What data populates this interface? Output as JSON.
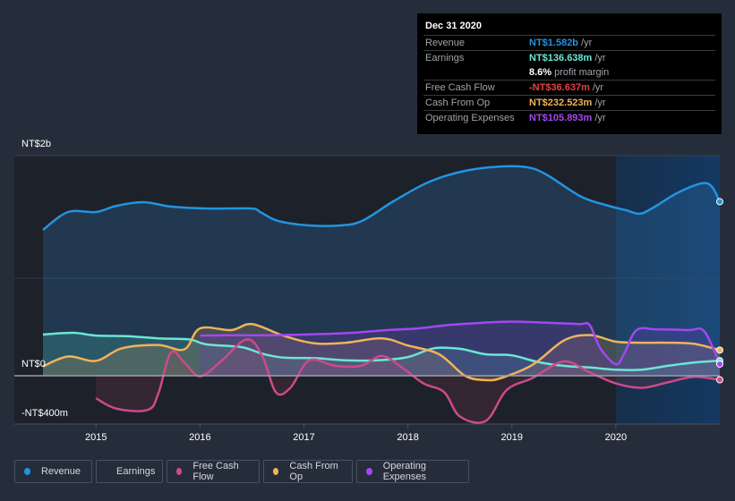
{
  "tooltip": {
    "date": "Dec 31 2020",
    "rows": [
      {
        "label": "Revenue",
        "value": "NT$1.582b",
        "unit": "/yr",
        "color": "#2394df"
      },
      {
        "label": "Earnings",
        "value": "NT$136.638m",
        "unit": "/yr",
        "color": "#6ce6d4"
      },
      {
        "label": "",
        "value": "8.6%",
        "unit": "profit margin",
        "color": "#ffffff"
      },
      {
        "label": "Free Cash Flow",
        "value": "-NT$36.637m",
        "unit": "/yr",
        "color": "#e64141"
      },
      {
        "label": "Cash From Op",
        "value": "NT$232.523m",
        "unit": "/yr",
        "color": "#f0b35a"
      },
      {
        "label": "Operating Expenses",
        "value": "NT$105.893m",
        "unit": "/yr",
        "color": "#a447f0"
      }
    ]
  },
  "legend": [
    {
      "label": "Revenue",
      "color": "#2394df"
    },
    {
      "label": "Earnings",
      "color": "#6ce6d4"
    },
    {
      "label": "Free Cash Flow",
      "color": "#cc4a8b"
    },
    {
      "label": "Cash From Op",
      "color": "#f0b35a"
    },
    {
      "label": "Operating Expenses",
      "color": "#a447f0"
    }
  ],
  "chart_data": {
    "type": "area",
    "title": "",
    "xlabel": "",
    "ylabel": "",
    "y_tick_labels": [
      "NT$2b",
      "NT$0",
      "-NT$400m"
    ],
    "y_ticks": [
      2000,
      0,
      -400
    ],
    "ylim": [
      -440,
      2000
    ],
    "xlim": [
      2014.49,
      2021.0
    ],
    "x_ticks": [
      2015,
      2016,
      2017,
      2018,
      2019,
      2020
    ],
    "x_tick_labels": [
      "2015",
      "2016",
      "2017",
      "2018",
      "2019",
      "2020"
    ],
    "unit": "NT$ millions",
    "highlight_start": 2020.0,
    "grid": true,
    "legend_position": "bottom",
    "series": [
      {
        "name": "Revenue",
        "color": "#2394df",
        "x": [
          2014.49,
          2014.73,
          2015.0,
          2015.2,
          2015.46,
          2015.72,
          2016.06,
          2016.49,
          2016.58,
          2016.75,
          2017.05,
          2017.35,
          2017.56,
          2017.86,
          2018.21,
          2018.55,
          2018.9,
          2019.15,
          2019.33,
          2019.67,
          2019.93,
          2020.1,
          2020.23,
          2020.36,
          2020.62,
          2020.88,
          2021.0
        ],
        "values": [
          1325,
          1488,
          1488,
          1545,
          1577,
          1537,
          1520,
          1520,
          1488,
          1407,
          1366,
          1366,
          1407,
          1585,
          1764,
          1862,
          1902,
          1894,
          1829,
          1626,
          1545,
          1504,
          1472,
          1528,
          1675,
          1748,
          1582
        ]
      },
      {
        "name": "Earnings",
        "color": "#6ce6d4",
        "x": [
          2014.49,
          2014.78,
          2015.0,
          2015.3,
          2015.6,
          2015.9,
          2016.06,
          2016.4,
          2016.6,
          2016.8,
          2017.1,
          2017.4,
          2017.7,
          2018.0,
          2018.25,
          2018.5,
          2018.75,
          2019.0,
          2019.25,
          2019.5,
          2019.75,
          2020.0,
          2020.25,
          2020.5,
          2020.75,
          2021.0
        ],
        "values": [
          375,
          390,
          365,
          360,
          340,
          330,
          285,
          260,
          200,
          165,
          160,
          140,
          140,
          170,
          250,
          245,
          195,
          185,
          125,
          90,
          75,
          55,
          55,
          90,
          120,
          137
        ]
      },
      {
        "name": "Free Cash Flow",
        "color": "#cc4a8b",
        "x": [
          2015.0,
          2015.2,
          2015.5,
          2015.6,
          2015.72,
          2015.85,
          2016.0,
          2016.2,
          2016.45,
          2016.6,
          2016.73,
          2016.87,
          2017.05,
          2017.3,
          2017.55,
          2017.75,
          2017.95,
          2018.15,
          2018.35,
          2018.5,
          2018.75,
          2018.95,
          2019.2,
          2019.5,
          2019.75,
          2020.0,
          2020.25,
          2020.5,
          2020.75,
          2021.0
        ],
        "values": [
          -205,
          -300,
          -310,
          -160,
          210,
          120,
          -5,
          130,
          330,
          180,
          -150,
          -110,
          140,
          90,
          90,
          180,
          70,
          -70,
          -150,
          -370,
          -410,
          -130,
          -20,
          130,
          30,
          -70,
          -110,
          -60,
          -10,
          -37
        ]
      },
      {
        "name": "Cash From Op",
        "color": "#f0b35a",
        "x": [
          2014.49,
          2014.73,
          2015.0,
          2015.25,
          2015.6,
          2015.85,
          2016.0,
          2016.3,
          2016.5,
          2016.8,
          2017.1,
          2017.4,
          2017.75,
          2018.0,
          2018.3,
          2018.55,
          2018.75,
          2018.9,
          2019.2,
          2019.5,
          2019.75,
          2020.0,
          2020.25,
          2020.5,
          2020.75,
          2021.0
        ],
        "values": [
          85,
          175,
          135,
          250,
          280,
          240,
          430,
          415,
          470,
          365,
          295,
          300,
          340,
          275,
          195,
          0,
          -40,
          -20,
          100,
          320,
          370,
          310,
          300,
          300,
          290,
          233
        ]
      },
      {
        "name": "Operating Expenses",
        "color": "#a447f0",
        "x": [
          2016.0,
          2016.3,
          2016.6,
          2016.9,
          2017.2,
          2017.5,
          2017.8,
          2018.1,
          2018.35,
          2018.6,
          2018.9,
          2019.1,
          2019.4,
          2019.65,
          2019.75,
          2019.85,
          2020.0,
          2020.08,
          2020.2,
          2020.4,
          2020.7,
          2020.85,
          2021.0
        ],
        "values": [
          365,
          368,
          368,
          372,
          380,
          393,
          415,
          430,
          458,
          475,
          490,
          490,
          480,
          470,
          460,
          250,
          105,
          200,
          415,
          420,
          415,
          405,
          106
        ]
      }
    ]
  }
}
